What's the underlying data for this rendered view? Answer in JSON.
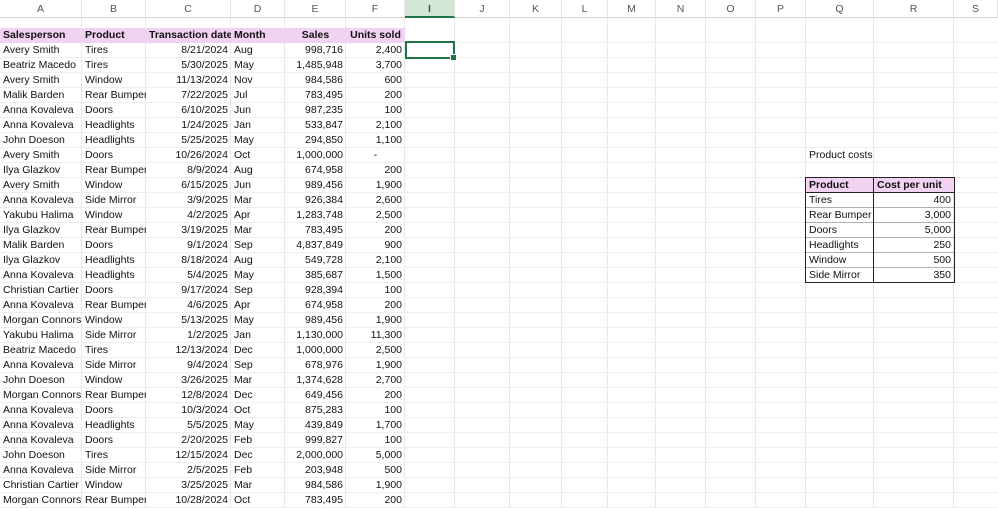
{
  "columns": [
    "A",
    "B",
    "C",
    "D",
    "E",
    "F",
    "I",
    "J",
    "K",
    "L",
    "M",
    "N",
    "O",
    "P",
    "Q",
    "R",
    "S"
  ],
  "selected_column": "I",
  "sales_table": {
    "headers": [
      "Salesperson",
      "Product",
      "Transaction date",
      "Month",
      "Sales",
      "Units sold"
    ],
    "rows": [
      [
        "Avery Smith",
        "Tires",
        "8/21/2024",
        "Aug",
        "998,716",
        "2,400"
      ],
      [
        "Beatriz Macedo",
        "Tires",
        "5/30/2025",
        "May",
        "1,485,948",
        "3,700"
      ],
      [
        "Avery Smith",
        "Window",
        "11/13/2024",
        "Nov",
        "984,586",
        "600"
      ],
      [
        "Malik Barden",
        "Rear Bumper",
        "7/22/2025",
        "Jul",
        "783,495",
        "200"
      ],
      [
        "Anna Kovaleva",
        "Doors",
        "6/10/2025",
        "Jun",
        "987,235",
        "100"
      ],
      [
        "Anna Kovaleva",
        "Headlights",
        "1/24/2025",
        "Jan",
        "533,847",
        "2,100"
      ],
      [
        "John Doeson",
        "Headlights",
        "5/25/2025",
        "May",
        "294,850",
        "1,100"
      ],
      [
        "Avery Smith",
        "Doors",
        "10/26/2024",
        "Oct",
        "1,000,000",
        "-"
      ],
      [
        "Ilya Glazkov",
        "Rear Bumper",
        "8/9/2024",
        "Aug",
        "674,958",
        "200"
      ],
      [
        "Avery Smith",
        "Window",
        "6/15/2025",
        "Jun",
        "989,456",
        "1,900"
      ],
      [
        "Anna Kovaleva",
        "Side Mirror",
        "3/9/2025",
        "Mar",
        "926,384",
        "2,600"
      ],
      [
        "Yakubu Halima",
        "Window",
        "4/2/2025",
        "Apr",
        "1,283,748",
        "2,500"
      ],
      [
        "Ilya Glazkov",
        "Rear Bumper",
        "3/19/2025",
        "Mar",
        "783,495",
        "200"
      ],
      [
        "Malik Barden",
        "Doors",
        "9/1/2024",
        "Sep",
        "4,837,849",
        "900"
      ],
      [
        "Ilya Glazkov",
        "Headlights",
        "8/18/2024",
        "Aug",
        "549,728",
        "2,100"
      ],
      [
        "Anna Kovaleva",
        "Headlights",
        "5/4/2025",
        "May",
        "385,687",
        "1,500"
      ],
      [
        "Christian Cartier",
        "Doors",
        "9/17/2024",
        "Sep",
        "928,394",
        "100"
      ],
      [
        "Anna Kovaleva",
        "Rear Bumper",
        "4/6/2025",
        "Apr",
        "674,958",
        "200"
      ],
      [
        "Morgan Connors",
        "Window",
        "5/13/2025",
        "May",
        "989,456",
        "1,900"
      ],
      [
        "Yakubu Halima",
        "Side Mirror",
        "1/2/2025",
        "Jan",
        "1,130,000",
        "11,300"
      ],
      [
        "Beatriz Macedo",
        "Tires",
        "12/13/2024",
        "Dec",
        "1,000,000",
        "2,500"
      ],
      [
        "Anna Kovaleva",
        "Side Mirror",
        "9/4/2024",
        "Sep",
        "678,976",
        "1,900"
      ],
      [
        "John Doeson",
        "Window",
        "3/26/2025",
        "Mar",
        "1,374,628",
        "2,700"
      ],
      [
        "Morgan Connors",
        "Rear Bumper",
        "12/8/2024",
        "Dec",
        "649,456",
        "200"
      ],
      [
        "Anna Kovaleva",
        "Doors",
        "10/3/2024",
        "Oct",
        "875,283",
        "100"
      ],
      [
        "Anna Kovaleva",
        "Headlights",
        "5/5/2025",
        "May",
        "439,849",
        "1,700"
      ],
      [
        "Anna Kovaleva",
        "Doors",
        "2/20/2025",
        "Feb",
        "999,827",
        "100"
      ],
      [
        "John Doeson",
        "Tires",
        "12/15/2024",
        "Dec",
        "2,000,000",
        "5,000"
      ],
      [
        "Anna Kovaleva",
        "Side Mirror",
        "2/5/2025",
        "Feb",
        "203,948",
        "500"
      ],
      [
        "Christian Cartier",
        "Window",
        "3/25/2025",
        "Mar",
        "984,586",
        "1,900"
      ],
      [
        "Morgan Connors",
        "Rear Bumper",
        "10/28/2024",
        "Oct",
        "783,495",
        "200"
      ]
    ]
  },
  "costs_table": {
    "title": "Product costs",
    "headers": [
      "Product",
      "Cost per unit"
    ],
    "rows": [
      [
        "Tires",
        "400"
      ],
      [
        "Rear Bumper",
        "3,000"
      ],
      [
        "Doors",
        "5,000"
      ],
      [
        "Headlights",
        "250"
      ],
      [
        "Window",
        "500"
      ],
      [
        "Side Mirror",
        "350"
      ]
    ]
  },
  "colors": {
    "header_fill": "#f1d2f1",
    "selection_green": "#217346",
    "selected_col_header": "#d3e7d9"
  }
}
